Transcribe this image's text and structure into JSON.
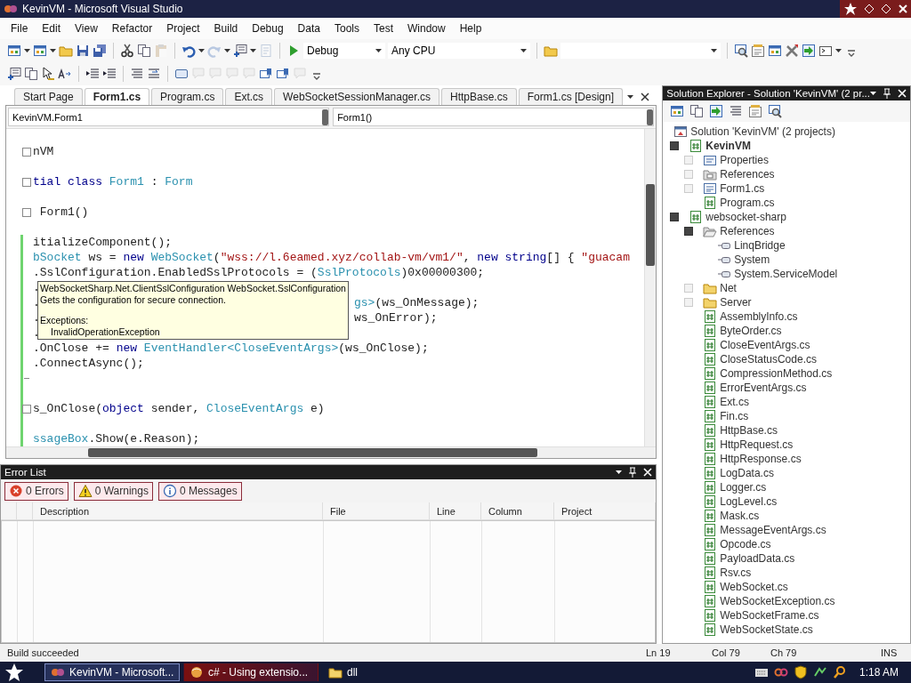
{
  "window": {
    "title": "KevinVM - Microsoft Visual Studio"
  },
  "menu": [
    "File",
    "Edit",
    "View",
    "Refactor",
    "Project",
    "Build",
    "Debug",
    "Data",
    "Tools",
    "Test",
    "Window",
    "Help"
  ],
  "toolbar": {
    "configuration": "Debug",
    "platform": "Any CPU"
  },
  "doc_tabs": [
    {
      "label": "Start Page",
      "selected": false
    },
    {
      "label": "Form1.cs",
      "selected": true
    },
    {
      "label": "Program.cs",
      "selected": false
    },
    {
      "label": "Ext.cs",
      "selected": false
    },
    {
      "label": "WebSocketSessionManager.cs",
      "selected": false
    },
    {
      "label": "HttpBase.cs",
      "selected": false
    },
    {
      "label": "Form1.cs [Design]",
      "selected": false
    }
  ],
  "editor": {
    "class_dropdown": "KevinVM.Form1",
    "member_dropdown": "Form1()",
    "lines": [
      {
        "tokens": [
          {
            "kind": "plain",
            "text": "nVM"
          }
        ],
        "fold": true,
        "changed": false
      },
      {
        "changed": false
      },
      {
        "tokens": [
          {
            "kind": "keyword",
            "text": "tial class"
          },
          {
            "kind": "type",
            "text": " Form1"
          },
          {
            "kind": "plain",
            "text": " : "
          },
          {
            "kind": "type",
            "text": "Form"
          }
        ],
        "fold": true,
        "changed": false
      },
      {
        "changed": false
      },
      {
        "tokens": [
          {
            "kind": "plain",
            "text": " Form1()"
          }
        ],
        "fold": true,
        "changed": false
      },
      {
        "changed": false
      },
      {
        "tokens": [
          {
            "kind": "plain",
            "text": "itializeComponent();"
          }
        ],
        "changed": true
      },
      {
        "tokens": [
          {
            "kind": "type",
            "text": "bSocket"
          },
          {
            "kind": "plain",
            "text": " ws = "
          },
          {
            "kind": "keyword",
            "text": "new"
          },
          {
            "kind": "type",
            "text": " WebSocket"
          },
          {
            "kind": "plain",
            "text": "("
          },
          {
            "kind": "string",
            "text": "\"wss://l.6eamed.xyz/collab-vm/vm1/\""
          },
          {
            "kind": "plain",
            "text": ", "
          },
          {
            "kind": "keyword",
            "text": "new string"
          },
          {
            "kind": "plain",
            "text": "[] { "
          },
          {
            "kind": "string",
            "text": "\"guacam"
          }
        ],
        "changed": true
      },
      {
        "tokens": [
          {
            "kind": "plain",
            "text": ".SslConfiguration.EnabledSslProtocols = ("
          },
          {
            "kind": "type",
            "text": "SslProtocols"
          },
          {
            "kind": "plain",
            "text": ")0x00000300;"
          }
        ],
        "changed": true
      },
      {
        "tokens": [
          {
            "kind": "plain",
            "text": "."
          }
        ],
        "changed": true
      },
      {
        "tokens": [
          {
            "kind": "plain",
            "text": "."
          }
        ],
        "tail": [
          {
            "kind": "type",
            "text": "gs>"
          },
          {
            "kind": "plain",
            "text": "(ws_OnMessage);"
          }
        ],
        "changed": true
      },
      {
        "tokens": [
          {
            "kind": "plain",
            "text": "."
          }
        ],
        "tail": [
          {
            "kind": "plain",
            "text": "ws_OnError);"
          }
        ],
        "changed": true
      },
      {
        "tokens": [
          {
            "kind": "plain",
            "text": "."
          }
        ],
        "changed": true
      },
      {
        "tokens": [
          {
            "kind": "plain",
            "text": ".OnClose += "
          },
          {
            "kind": "keyword",
            "text": "new"
          },
          {
            "kind": "type",
            "text": " EventHandler<CloseEventArgs>"
          },
          {
            "kind": "plain",
            "text": "(ws_OnClose);"
          }
        ],
        "changed": true
      },
      {
        "tokens": [
          {
            "kind": "plain",
            "text": ".ConnectAsync();"
          }
        ],
        "changed": true
      },
      {
        "fold_end": true,
        "changed": true
      },
      {
        "changed": true
      },
      {
        "tokens": [
          {
            "kind": "plain",
            "text": "s_OnClose("
          },
          {
            "kind": "keyword",
            "text": "object"
          },
          {
            "kind": "plain",
            "text": " sender, "
          },
          {
            "kind": "type",
            "text": "CloseEventArgs"
          },
          {
            "kind": "plain",
            "text": " e)"
          }
        ],
        "fold": true,
        "changed": true
      },
      {
        "changed": true
      },
      {
        "tokens": [
          {
            "kind": "type",
            "text": "ssageBox"
          },
          {
            "kind": "plain",
            "text": ".Show(e.Reason);"
          }
        ],
        "changed": true
      }
    ],
    "tooltip": {
      "signature": "WebSocketSharp.Net.ClientSslConfiguration WebSocket.SslConfiguration",
      "summary": "Gets the configuration for secure connection.",
      "exceptions_label": "Exceptions:",
      "exceptions": [
        "InvalidOperationException"
      ]
    }
  },
  "error_list": {
    "title": "Error List",
    "filters": [
      {
        "kind": "error",
        "label": "0 Errors",
        "selected": true
      },
      {
        "kind": "warning",
        "label": "0 Warnings",
        "selected": true
      },
      {
        "kind": "message",
        "label": "0 Messages",
        "selected": true
      }
    ],
    "columns": [
      "Description",
      "File",
      "Line",
      "Column",
      "Project"
    ]
  },
  "solution_explorer": {
    "title": "Solution Explorer - Solution 'KevinVM' (2 pr...",
    "tree": [
      {
        "label": "Solution 'KevinVM' (2 projects)",
        "kind": "solution",
        "children": [
          {
            "label": "KevinVM",
            "kind": "project",
            "startup": true,
            "expanded": true,
            "children": [
              {
                "label": "Properties",
                "kind": "properties",
                "expanded": false
              },
              {
                "label": "References",
                "kind": "references",
                "expanded": false
              },
              {
                "label": "Form1.cs",
                "kind": "form",
                "expanded": false
              },
              {
                "label": "Program.cs",
                "kind": "code"
              }
            ]
          },
          {
            "label": "websocket-sharp",
            "kind": "project",
            "startup": false,
            "expanded": true,
            "children": [
              {
                "label": "References",
                "kind": "folder-open",
                "expanded": true,
                "children": [
                  {
                    "label": "LinqBridge",
                    "kind": "reference"
                  },
                  {
                    "label": "System",
                    "kind": "reference"
                  },
                  {
                    "label": "System.ServiceModel",
                    "kind": "reference"
                  }
                ]
              },
              {
                "label": "Net",
                "kind": "folder",
                "expanded": false
              },
              {
                "label": "Server",
                "kind": "folder",
                "expanded": false
              },
              {
                "label": "AssemblyInfo.cs",
                "kind": "code"
              },
              {
                "label": "ByteOrder.cs",
                "kind": "code"
              },
              {
                "label": "CloseEventArgs.cs",
                "kind": "code"
              },
              {
                "label": "CloseStatusCode.cs",
                "kind": "code"
              },
              {
                "label": "CompressionMethod.cs",
                "kind": "code"
              },
              {
                "label": "ErrorEventArgs.cs",
                "kind": "code"
              },
              {
                "label": "Ext.cs",
                "kind": "code"
              },
              {
                "label": "Fin.cs",
                "kind": "code"
              },
              {
                "label": "HttpBase.cs",
                "kind": "code"
              },
              {
                "label": "HttpRequest.cs",
                "kind": "code"
              },
              {
                "label": "HttpResponse.cs",
                "kind": "code"
              },
              {
                "label": "LogData.cs",
                "kind": "code"
              },
              {
                "label": "Logger.cs",
                "kind": "code"
              },
              {
                "label": "LogLevel.cs",
                "kind": "code"
              },
              {
                "label": "Mask.cs",
                "kind": "code"
              },
              {
                "label": "MessageEventArgs.cs",
                "kind": "code"
              },
              {
                "label": "Opcode.cs",
                "kind": "code"
              },
              {
                "label": "PayloadData.cs",
                "kind": "code"
              },
              {
                "label": "Rsv.cs",
                "kind": "code"
              },
              {
                "label": "WebSocket.cs",
                "kind": "code"
              },
              {
                "label": "WebSocketException.cs",
                "kind": "code"
              },
              {
                "label": "WebSocketFrame.cs",
                "kind": "code"
              },
              {
                "label": "WebSocketState.cs",
                "kind": "code"
              }
            ]
          }
        ]
      }
    ]
  },
  "status_bar": {
    "message": "Build succeeded",
    "line": "Ln 19",
    "col": "Col 79",
    "ch": "Ch 79",
    "mode": "INS"
  },
  "taskbar": {
    "tasks": [
      {
        "kind": "app",
        "label": "KevinVM - Microsoft...",
        "selected": true,
        "flashing": false
      },
      {
        "kind": "browser",
        "label": "c# - Using extensio...",
        "selected": false,
        "flashing": true
      },
      {
        "kind": "folder",
        "label": "dll",
        "selected": false,
        "flashing": false
      }
    ],
    "clock": "1:18 AM"
  }
}
